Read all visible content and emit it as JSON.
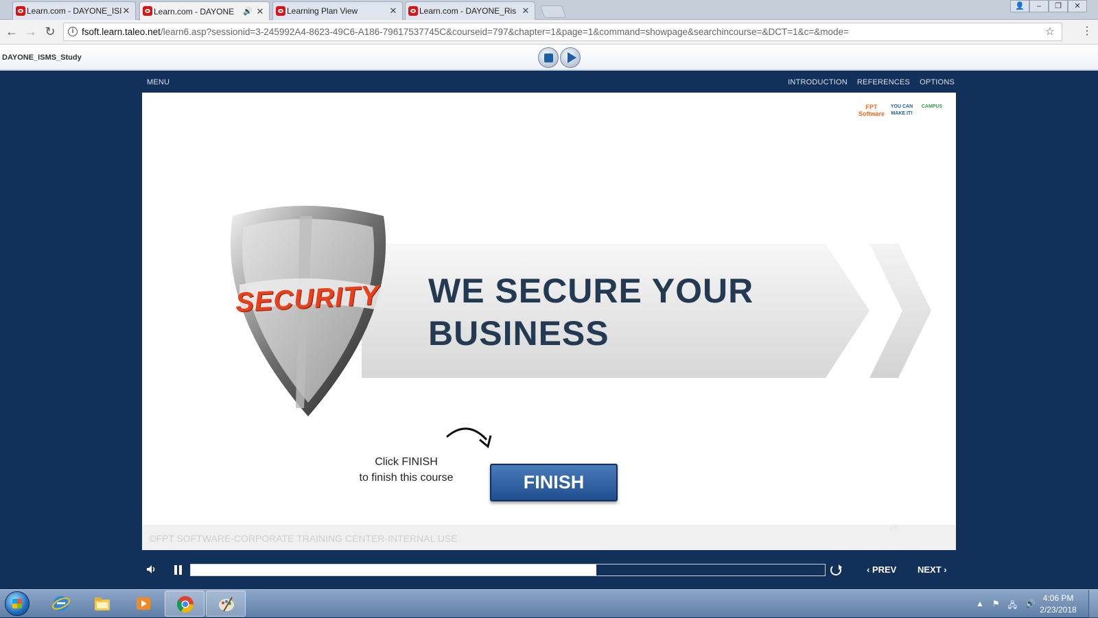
{
  "browser": {
    "tabs": [
      {
        "title": "Learn.com - DAYONE_ISI",
        "active": false,
        "audio": false
      },
      {
        "title": "Learn.com - DAYONE",
        "active": true,
        "audio": true
      },
      {
        "title": "Learning Plan View",
        "active": false,
        "audio": false
      },
      {
        "title": "Learn.com - DAYONE_Ris",
        "active": false,
        "audio": false
      }
    ],
    "url_host": "fsoft.learn.taleo.net",
    "url_path": "/learn6.asp?sessionid=3-245992A4-8623-49C6-A186-79617537745C&courseid=797&chapter=1&page=1&command=showpage&searchincourse=&DCT=1&c=&mode="
  },
  "lms": {
    "course_name": "DAYONE_ISMS_Study"
  },
  "player": {
    "menu_label": "MENU",
    "top_links": [
      "INTRODUCTION",
      "REFERENCES",
      "OPTIONS"
    ],
    "progress_fraction": 0.64,
    "prev_label": "PREV",
    "next_label": "NEXT"
  },
  "slide": {
    "logos": [
      "FPT Software",
      "YOU CAN MAKE IT!",
      "CAMPUS"
    ],
    "shield_text": "SECURITY",
    "headline_line1": "WE SECURE YOUR",
    "headline_line2": "BUSINESS",
    "hint_line1": "Click FINISH",
    "hint_line2": "to finish this course",
    "finish_label": "FINISH",
    "footer_text": "©FPT SOFTWARE-CORPORATE TRAINING CENTER-INTERNAL USE",
    "page_marker": "(#)"
  },
  "taskbar": {
    "apps": [
      "internet-explorer",
      "file-explorer",
      "media-player",
      "chrome",
      "paint"
    ],
    "time": "4:06 PM",
    "date": "2/23/2018"
  }
}
